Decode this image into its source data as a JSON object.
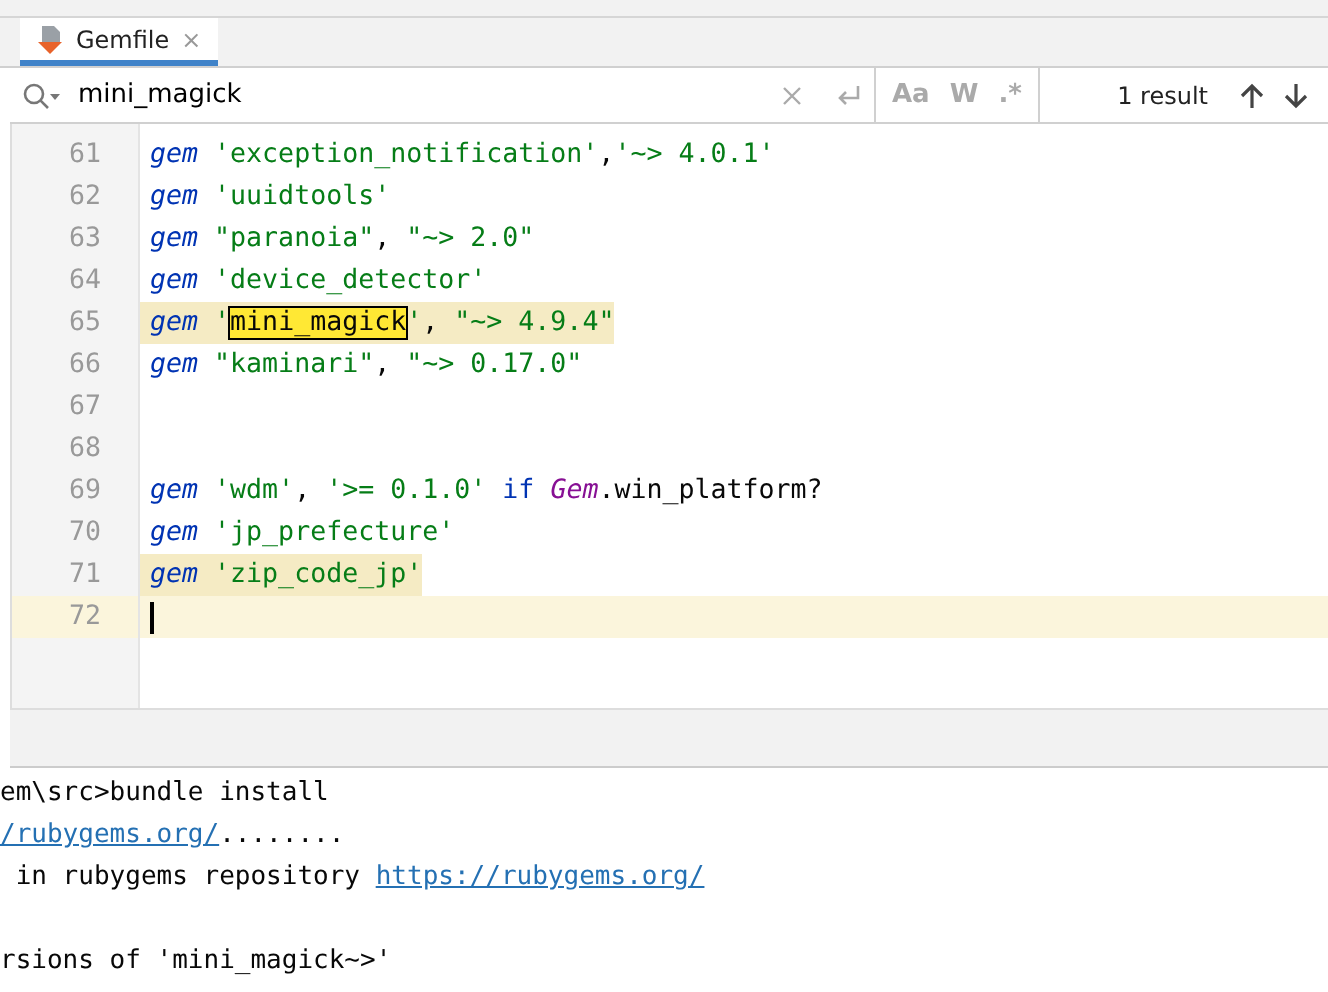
{
  "tabs": [
    {
      "label": "Gemfile",
      "close": "×",
      "selected": true
    }
  ],
  "search": {
    "value": "mini_magick",
    "options": [
      {
        "label": "Aa",
        "selected": false
      },
      {
        "label": "W",
        "selected": false
      },
      {
        "label": ".*",
        "selected": false
      }
    ],
    "result_count": "1 result"
  },
  "editor": {
    "lines": [
      {
        "number": "61",
        "highlight": false,
        "current": false,
        "tokens": [
          {
            "kind": "keyword",
            "text": "gem"
          },
          {
            "kind": "string",
            "text": " 'exception_notification'"
          },
          {
            "kind": "plain",
            "text": ","
          },
          {
            "kind": "string",
            "text": "'~> 4.0.1'"
          }
        ]
      },
      {
        "number": "62",
        "highlight": false,
        "current": false,
        "tokens": [
          {
            "kind": "keyword",
            "text": "gem"
          },
          {
            "kind": "string",
            "text": " 'uuidtools'"
          }
        ]
      },
      {
        "number": "63",
        "highlight": false,
        "current": false,
        "tokens": [
          {
            "kind": "keyword",
            "text": "gem"
          },
          {
            "kind": "string",
            "text": " \"paranoia\""
          },
          {
            "kind": "plain",
            "text": ","
          },
          {
            "kind": "string",
            "text": " \"~> 2.0\""
          }
        ]
      },
      {
        "number": "64",
        "highlight": false,
        "current": false,
        "tokens": [
          {
            "kind": "keyword",
            "text": "gem"
          },
          {
            "kind": "string",
            "text": " 'device_detector'"
          }
        ]
      },
      {
        "number": "65",
        "highlight": true,
        "current": false,
        "tokens": [
          {
            "kind": "keyword",
            "text": "gem"
          },
          {
            "kind": "string",
            "text": " '"
          },
          {
            "kind": "match",
            "text": "mini_magick"
          },
          {
            "kind": "string",
            "text": "'"
          },
          {
            "kind": "plain",
            "text": ","
          },
          {
            "kind": "string",
            "text": " \"~> 4.9.4\""
          }
        ]
      },
      {
        "number": "66",
        "highlight": false,
        "current": false,
        "tokens": [
          {
            "kind": "keyword",
            "text": "gem"
          },
          {
            "kind": "string",
            "text": " \"kaminari\""
          },
          {
            "kind": "plain",
            "text": ","
          },
          {
            "kind": "string",
            "text": " \"~> 0.17.0\""
          }
        ]
      },
      {
        "number": "67",
        "highlight": false,
        "current": false
      },
      {
        "number": "68",
        "highlight": false,
        "current": false
      },
      {
        "number": "69",
        "highlight": false,
        "current": false,
        "tokens": [
          {
            "kind": "keyword",
            "text": "gem"
          },
          {
            "kind": "string",
            "text": " 'wdm'"
          },
          {
            "kind": "plain",
            "text": ","
          },
          {
            "kind": "string",
            "text": " '>= 0.1.0'"
          },
          {
            "kind": "control",
            "text": " if"
          },
          {
            "kind": "constant",
            "text": " Gem"
          },
          {
            "kind": "plain",
            "text": ".win_platform?"
          }
        ]
      },
      {
        "number": "70",
        "highlight": false,
        "current": false,
        "tokens": [
          {
            "kind": "keyword",
            "text": "gem"
          },
          {
            "kind": "string",
            "text": " 'jp_prefecture'"
          }
        ]
      },
      {
        "number": "71",
        "highlight": true,
        "current": false,
        "tokens": [
          {
            "kind": "keyword",
            "text": "gem"
          },
          {
            "kind": "string",
            "text": " 'zip_code_jp'"
          }
        ]
      },
      {
        "number": "72",
        "highlight": false,
        "current": true
      }
    ]
  },
  "terminal": {
    "blocks": [
      [
        [
          {
            "kind": "plain",
            "text": "em\\src>bundle install"
          }
        ],
        [
          {
            "kind": "link",
            "text": "/rubygems.org/"
          },
          {
            "kind": "plain",
            "text": "........"
          }
        ],
        [
          {
            "kind": "plain",
            "text": " in rubygems repository "
          },
          {
            "kind": "link",
            "text": "https://rubygems.org/"
          }
        ]
      ],
      [
        [
          {
            "kind": "plain",
            "text": "rsions of 'mini_magick~>'"
          }
        ]
      ]
    ]
  }
}
